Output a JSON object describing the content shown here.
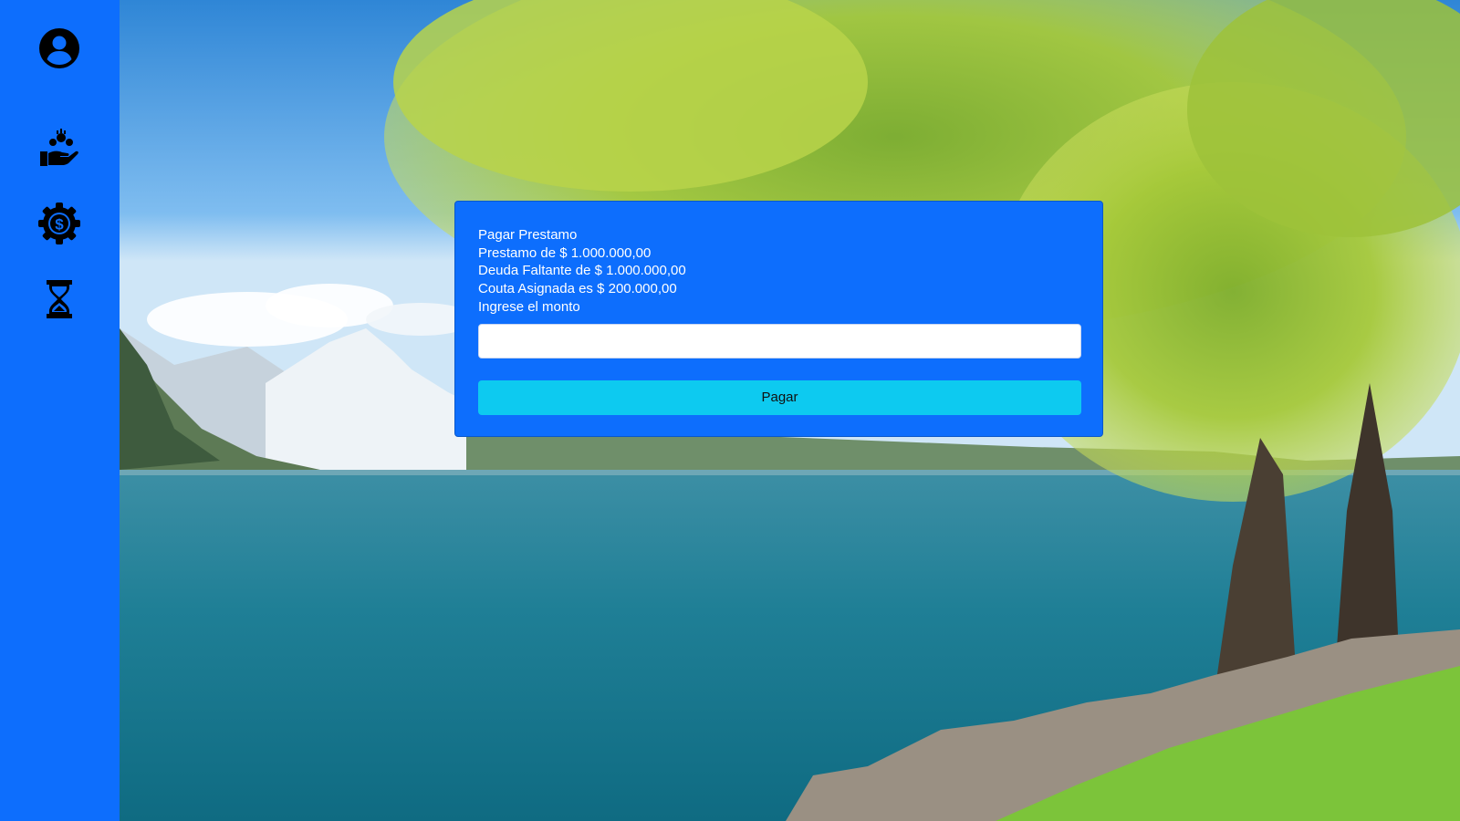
{
  "sidebar": {
    "items": [
      {
        "icon": "user-circle-icon"
      },
      {
        "icon": "hand-money-icon"
      },
      {
        "icon": "gear-dollar-icon"
      },
      {
        "icon": "hourglass-icon"
      }
    ]
  },
  "background": {
    "description_icon": "lake-mountain-tree-scene"
  },
  "card": {
    "title": "Pagar Prestamo",
    "loan_line": "Prestamo de $ 1.000.000,00",
    "debt_line": "Deuda Faltante de $ 1.000.000,00",
    "quota_line": "Couta Asignada es $ 200.000,00",
    "amount_prompt": "Ingrese el monto",
    "amount_value": "",
    "pay_label": "Pagar"
  },
  "colors": {
    "primary": "#0d6efd",
    "button": "#0dcaf0",
    "text": "#ffffff"
  }
}
